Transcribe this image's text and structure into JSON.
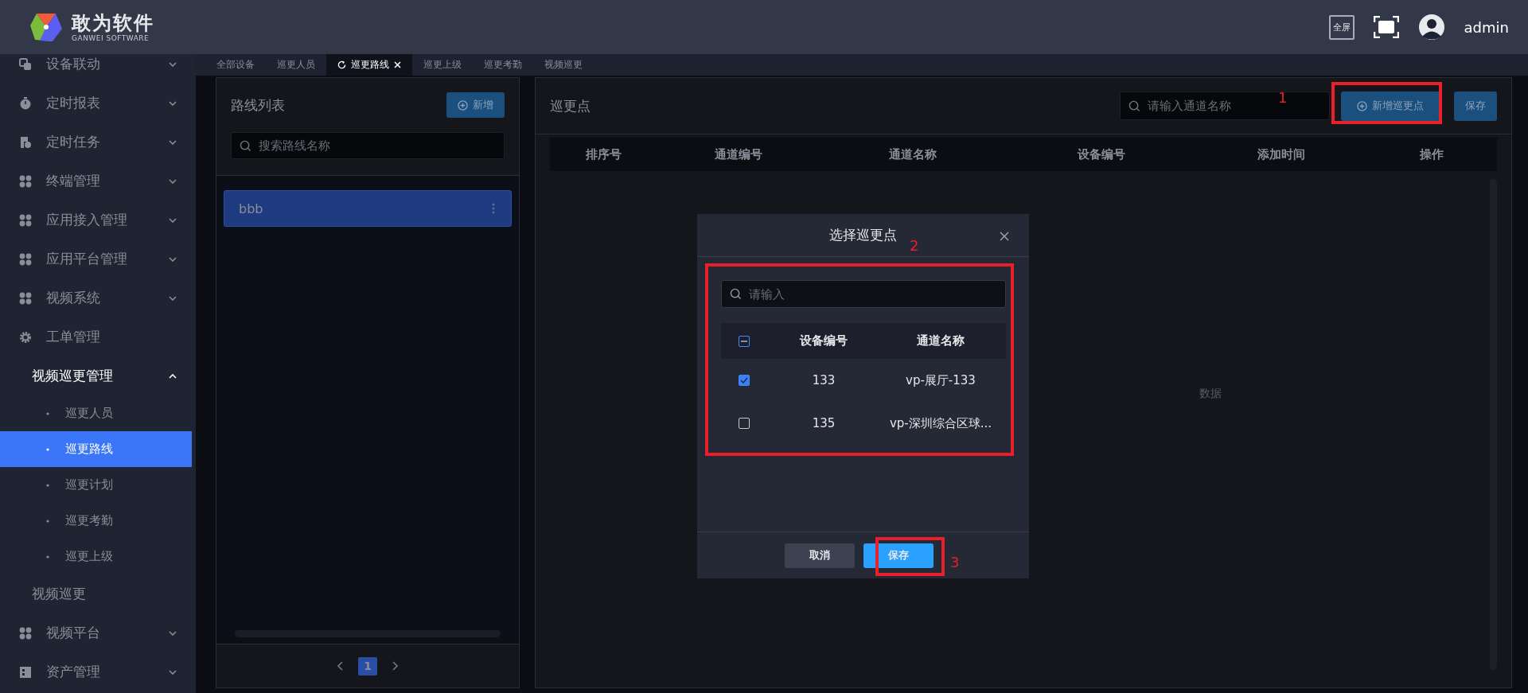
{
  "header": {
    "logo_title": "敢为软件",
    "logo_subtitle": "GANWEI SOFTWARE",
    "fullscreen_label": "全屏",
    "user": "admin"
  },
  "sidebar": {
    "items": [
      {
        "label": "设备联动",
        "kind": "group",
        "expanded": false
      },
      {
        "label": "定时报表",
        "kind": "group",
        "expanded": false
      },
      {
        "label": "定时任务",
        "kind": "group",
        "expanded": false
      },
      {
        "label": "终端管理",
        "kind": "group",
        "expanded": false
      },
      {
        "label": "应用接入管理",
        "kind": "group",
        "expanded": false
      },
      {
        "label": "应用平台管理",
        "kind": "group",
        "expanded": false
      },
      {
        "label": "视频系统",
        "kind": "group",
        "expanded": false
      },
      {
        "label": "工单管理",
        "kind": "link"
      },
      {
        "label": "视频巡更管理",
        "kind": "group",
        "expanded": true,
        "children": [
          {
            "label": "巡更人员",
            "selected": false
          },
          {
            "label": "巡更路线",
            "selected": true
          },
          {
            "label": "巡更计划",
            "selected": false
          },
          {
            "label": "巡更考勤",
            "selected": false
          },
          {
            "label": "巡更上级",
            "selected": false
          }
        ]
      },
      {
        "label": "视频巡更",
        "kind": "link"
      },
      {
        "label": "视频平台",
        "kind": "group",
        "expanded": false
      },
      {
        "label": "资产管理",
        "kind": "group",
        "expanded": false
      }
    ]
  },
  "tabs": [
    {
      "label": "全部设备",
      "selected": false
    },
    {
      "label": "巡更人员",
      "selected": false
    },
    {
      "label": "巡更路线",
      "selected": true
    },
    {
      "label": "巡更上级",
      "selected": false
    },
    {
      "label": "巡更考勤",
      "selected": false
    },
    {
      "label": "视频巡更",
      "selected": false
    }
  ],
  "route_panel": {
    "title": "路线列表",
    "add_button": "新增",
    "search": {
      "placeholder": "搜索路线名称"
    },
    "routes": [
      {
        "name": "bbb",
        "selected": true
      }
    ],
    "pagination": [
      {
        "label": "1",
        "selected": true
      }
    ]
  },
  "points_panel": {
    "title": "巡更点",
    "search": {
      "placeholder": "请输入通道名称"
    },
    "add_button": "新增巡更点",
    "save_button": "保存",
    "columns": [
      "排序号",
      "通道编号",
      "通道名称",
      "设备编号",
      "添加时间",
      "操作"
    ],
    "empty_text": "数据"
  },
  "dialog": {
    "title": "选择巡更点",
    "search": {
      "placeholder": "请输入"
    },
    "select_all": {
      "indeterminate": true
    },
    "columns": [
      "设备编号",
      "通道名称"
    ],
    "rows": [
      {
        "device": "133",
        "channel": "vp-展厅-133",
        "checked": true
      },
      {
        "device": "135",
        "channel": "vp-深圳综合区球...",
        "checked": false
      }
    ],
    "cancel_button": "取消",
    "save_button": "保存"
  },
  "annotations": [
    {
      "label": "1"
    },
    {
      "label": "2"
    },
    {
      "label": "3"
    }
  ]
}
